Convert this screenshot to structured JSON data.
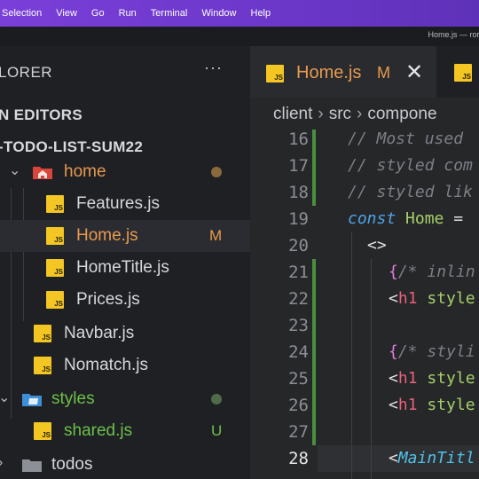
{
  "menubar": {
    "items": [
      "Selection",
      "View",
      "Go",
      "Run",
      "Terminal",
      "Window",
      "Help"
    ]
  },
  "window_title": "Home.js — ror-t",
  "sidebar": {
    "explorer_label": "LORER",
    "more_label": "···",
    "open_editors_label": "N EDITORS",
    "project_label": "-TODO-LIST-SUM22",
    "tree": [
      {
        "label": "home",
        "type": "folder-home",
        "status": "dot"
      },
      {
        "label": "Features.js",
        "type": "js"
      },
      {
        "label": "Home.js",
        "type": "js",
        "status_letter": "M",
        "selected": true
      },
      {
        "label": "HomeTitle.js",
        "type": "js"
      },
      {
        "label": "Prices.js",
        "type": "js"
      },
      {
        "label": "Navbar.js",
        "type": "js"
      },
      {
        "label": "Nomatch.js",
        "type": "js"
      },
      {
        "label": "styles",
        "type": "folder-styles",
        "status": "dot"
      },
      {
        "label": "shared.js",
        "type": "js",
        "status_letter": "U"
      },
      {
        "label": "todos",
        "type": "folder"
      }
    ],
    "js_badge": "JS"
  },
  "editor": {
    "active_tab": {
      "label": "Home.js",
      "status": "M",
      "close": "✕"
    },
    "second_tab_badge": "JS",
    "breadcrumb": [
      "client",
      "src",
      "compone"
    ],
    "lines": [
      {
        "n": "16"
      },
      {
        "n": "17"
      },
      {
        "n": "18"
      },
      {
        "n": "19"
      },
      {
        "n": "20"
      },
      {
        "n": "21"
      },
      {
        "n": "22"
      },
      {
        "n": "23"
      },
      {
        "n": "24"
      },
      {
        "n": "25"
      },
      {
        "n": "26"
      },
      {
        "n": "27"
      },
      {
        "n": "28"
      }
    ],
    "code": {
      "l16": "// Most used",
      "l17": "// styled com",
      "l18": "// styled lik",
      "l19_kw": "const",
      "l19_name": "Home",
      "l19_op": "=",
      "l20": "<>",
      "l21_open": "{",
      "l21_comment": "/* inlin",
      "l22_lt": "<",
      "l22_tag": "h1",
      "l22_attr": "style",
      "l24_open": "{",
      "l24_comment": "/* styli",
      "l25_lt": "<",
      "l25_tag": "h1",
      "l25_attr": "style",
      "l26_lt": "<",
      "l26_tag": "h1",
      "l26_attr": "style",
      "l28_lt": "<",
      "l28_comp": "MainTitl"
    }
  },
  "colors": {
    "menubar": "#6b37c9",
    "js_badge": "#f3c623",
    "modified": "#e79a4f",
    "untracked": "#6cc04a",
    "git_added_bar": "#4a8f3d"
  }
}
